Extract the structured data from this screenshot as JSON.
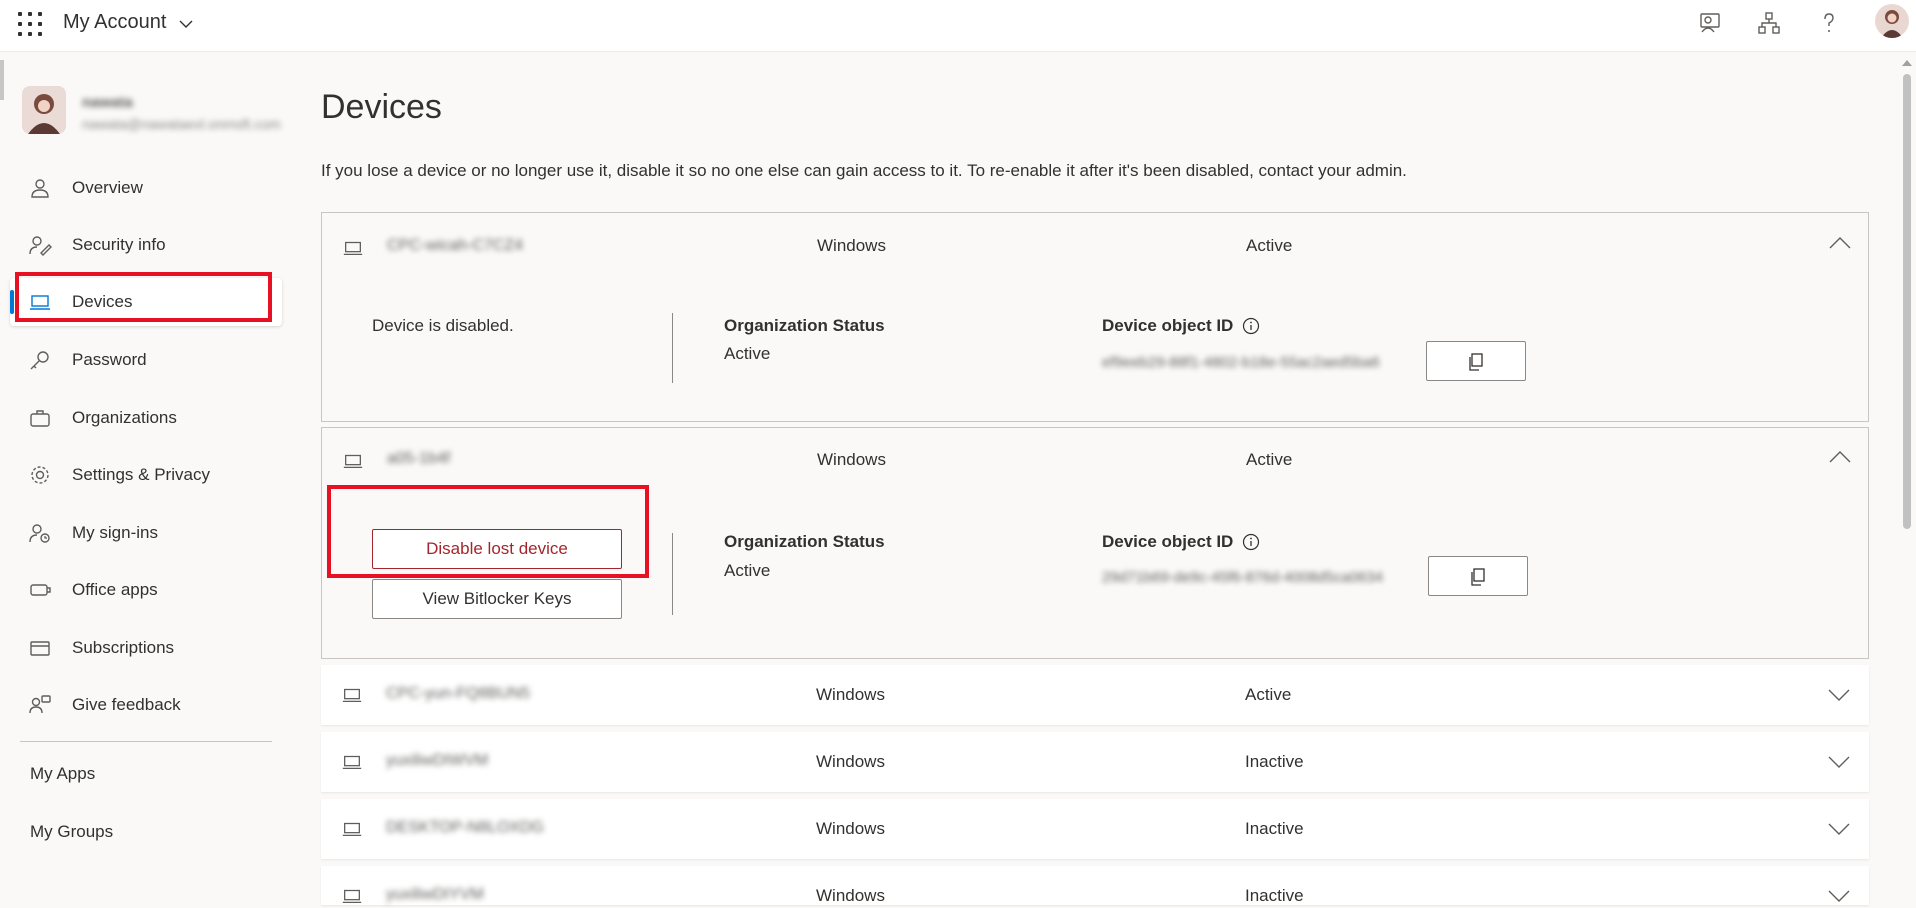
{
  "header": {
    "app_title": "My Account",
    "icons": [
      "waffle-icon",
      "feedback-icon",
      "org-chart-icon",
      "help-icon",
      "user-avatar"
    ]
  },
  "profile": {
    "name": "nawata",
    "email": "nawata@nawataexl.onmsft.com"
  },
  "sidebar": {
    "items": [
      {
        "label": "Overview",
        "icon": "person-icon"
      },
      {
        "label": "Security info",
        "icon": "security-info-icon"
      },
      {
        "label": "Devices",
        "icon": "laptop-icon",
        "selected": true
      },
      {
        "label": "Password",
        "icon": "key-icon"
      },
      {
        "label": "Organizations",
        "icon": "briefcase-icon"
      },
      {
        "label": "Settings & Privacy",
        "icon": "gear-icon"
      },
      {
        "label": "My sign-ins",
        "icon": "sign-ins-icon"
      },
      {
        "label": "Office apps",
        "icon": "office-apps-icon"
      },
      {
        "label": "Subscriptions",
        "icon": "card-icon"
      },
      {
        "label": "Give feedback",
        "icon": "feedback-people-icon"
      }
    ],
    "links": [
      "My Apps",
      "My Groups"
    ]
  },
  "main": {
    "title": "Devices",
    "description": "If you lose a device or no longer use it, disable it so no one else can gain access to it. To re-enable it after it's been disabled, contact your admin.",
    "devices": [
      {
        "name": "CPC-wicah-C7CZ4",
        "os": "Windows",
        "status": "Active",
        "expanded": true,
        "disabled_text": "Device is disabled.",
        "org_status_label": "Organization Status",
        "org_status": "Active",
        "object_id_label": "Device object ID",
        "object_id": "ef9eeb29-88f1-4802-b18e-55ac2aed5ba6"
      },
      {
        "name": "a05-1b4f",
        "os": "Windows",
        "status": "Active",
        "expanded": true,
        "disable_button": "Disable lost device",
        "bitlocker_button": "View Bitlocker Keys",
        "org_status_label": "Organization Status",
        "org_status": "Active",
        "object_id_label": "Device object ID",
        "object_id": "29d71b69-de9c-45f6-876d-4008d5ca0634"
      },
      {
        "name": "CPC-yun-FQ8BUN5",
        "os": "Windows",
        "status": "Active",
        "expanded": false
      },
      {
        "name": "yuxiliwDIWVM",
        "os": "Windows",
        "status": "Inactive",
        "expanded": false
      },
      {
        "name": "DESKTOP-N8LOXDG",
        "os": "Windows",
        "status": "Inactive",
        "expanded": false
      },
      {
        "name": "yuxiliwDIYVM",
        "os": "Windows",
        "status": "Inactive",
        "expanded": false
      }
    ]
  },
  "colors": {
    "accent": "#0078d4",
    "danger": "#a4262c",
    "highlight": "#e81123"
  }
}
